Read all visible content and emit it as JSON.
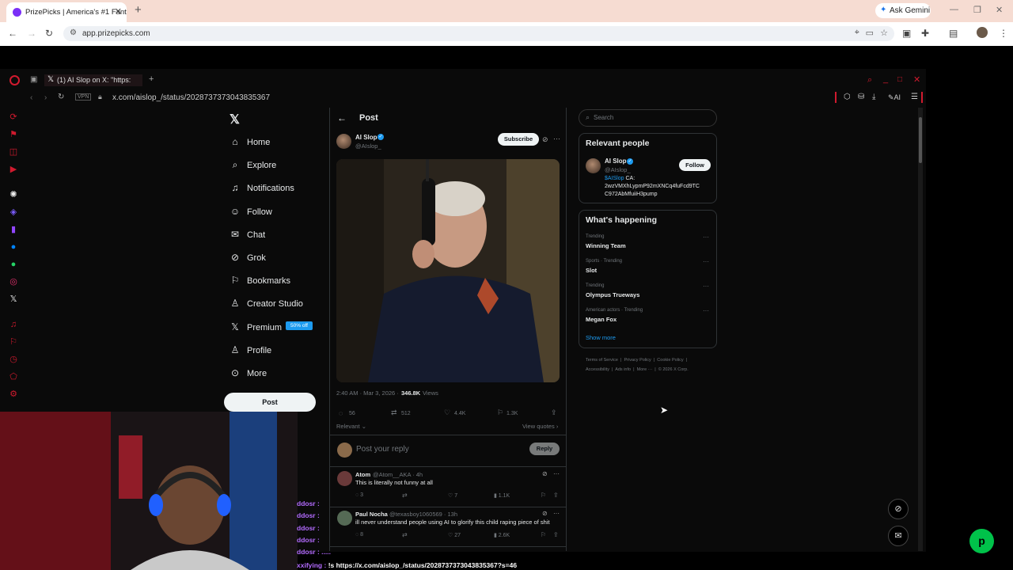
{
  "chrome": {
    "tab_title": "PrizePicks | America's #1 Fantas",
    "ask_gemini": "Ask Gemini",
    "url": "app.prizepicks.com"
  },
  "gx": {
    "tab_title": "(1) AI Slop on X: \"https:",
    "vpn": "VPN",
    "url": "x.com/aislop_/status/2028737373043835367",
    "ai_label": "AI"
  },
  "x": {
    "nav": [
      {
        "label": "Home",
        "icon": "home-icon"
      },
      {
        "label": "Explore",
        "icon": "search-icon"
      },
      {
        "label": "Notifications",
        "icon": "bell-icon"
      },
      {
        "label": "Follow",
        "icon": "follow-icon"
      },
      {
        "label": "Chat",
        "icon": "mail-icon"
      },
      {
        "label": "Grok",
        "icon": "grok-icon"
      },
      {
        "label": "Bookmarks",
        "icon": "bookmark-icon"
      },
      {
        "label": "Creator Studio",
        "icon": "creator-icon"
      },
      {
        "label": "Premium",
        "icon": "x-icon"
      },
      {
        "label": "Profile",
        "icon": "profile-icon"
      },
      {
        "label": "More",
        "icon": "more-icon"
      }
    ],
    "premium_badge": "50% off",
    "post_button": "Post",
    "header": "Post",
    "author": {
      "name": "AI Slop",
      "handle": "@AIslop_"
    },
    "subscribe": "Subscribe",
    "meta": {
      "time": "2:40 AM · Mar 3, 2026 ·",
      "views": "346.8K",
      "views_label": "Views"
    },
    "stats": {
      "replies": "56",
      "reposts": "512",
      "likes": "4.4K",
      "bookmarks": "1.3K"
    },
    "sort_label": "Relevant",
    "view_quotes": "View quotes",
    "reply_placeholder": "Post your reply",
    "reply_button": "Reply",
    "replies": [
      {
        "name": "Atom",
        "handle": "@Atom__AKA · 4h",
        "text": "This is literally not funny at all",
        "c": "3",
        "l": "7",
        "v": "1.1K"
      },
      {
        "name": "Paul Nocha",
        "handle": "@texasboy1060569 · 13h",
        "text": "ill never understand people using AI to glorify this child raping piece of shit",
        "c": "8",
        "l": "27",
        "v": "2.6K"
      }
    ],
    "search_placeholder": "Search",
    "relevant_people": {
      "title": "Relevant people",
      "name": "AI Slop",
      "handle": "@AIslop_",
      "follow": "Follow",
      "bio_link": "$AISlop",
      "bio_rest": " CA:",
      "bio_line2": "2wzVMXhLypmP92mXNCq4fuFcd9TC",
      "bio_line3": "C972AbMfuiiH3pump"
    },
    "happening": {
      "title": "What's happening",
      "items": [
        {
          "meta": "Trending",
          "name": "Winning Team"
        },
        {
          "meta": "Sports · Trending",
          "name": "Slot"
        },
        {
          "meta": "Trending",
          "name": "Olympus Trueways"
        },
        {
          "meta": "American actors · Trending",
          "name": "Megan Fox"
        }
      ],
      "show_more": "Show more"
    },
    "footer": {
      "line1": [
        "Terms of Service",
        "Privacy Policy",
        "Cookie Policy"
      ],
      "line2": [
        "Accessibility",
        "Ads info",
        "More ···",
        "© 2026 X Corp."
      ]
    }
  },
  "stream_chat": {
    "names": [
      "ddosr :",
      "ddosr :",
      "ddosr :",
      "ddosr :",
      "ddosr : ....."
    ],
    "last_user": "xxifying :",
    "last_text": "!s https://x.com/aislop_/status/2028737373043835367?s=46"
  },
  "colors": {
    "accent": "#1d9bf0",
    "gx_red": "#d01a2e",
    "prizepicks_green": "#00c24a"
  }
}
